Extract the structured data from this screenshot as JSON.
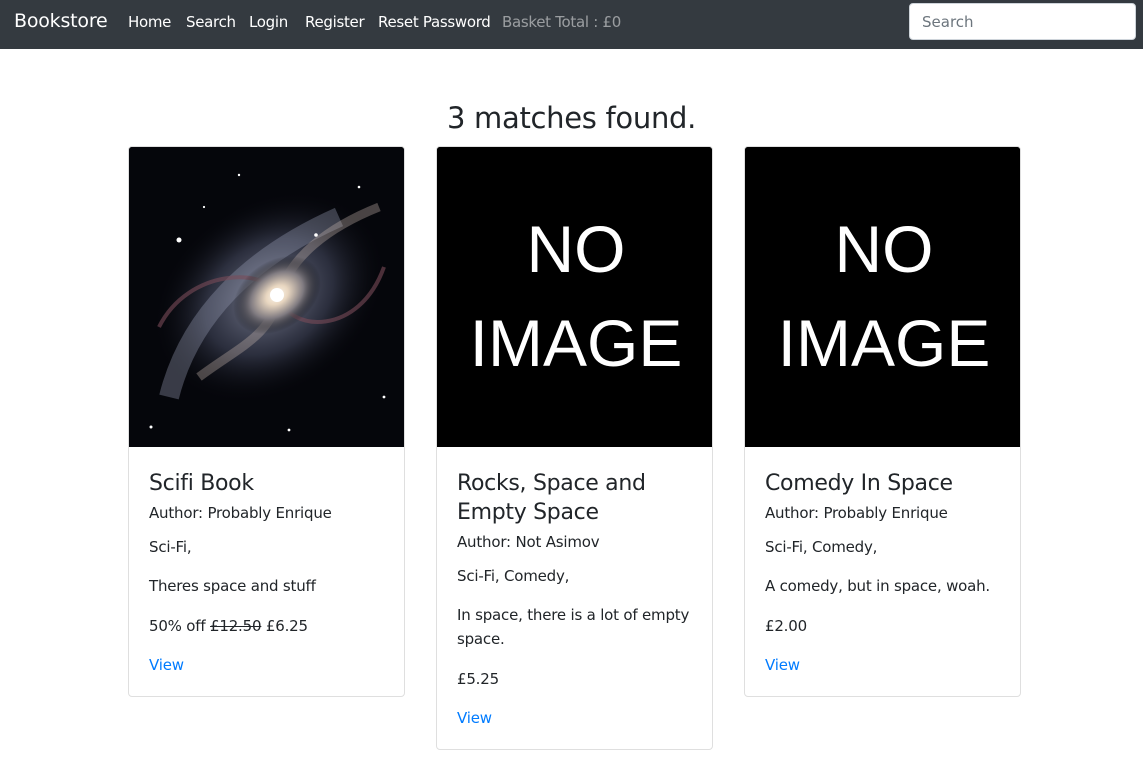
{
  "navbar": {
    "brand": "Bookstore",
    "links": [
      "Home",
      "Search",
      "Login",
      "Register",
      "Reset Password"
    ],
    "basket_total": "Basket Total : £0",
    "search_placeholder": "Search"
  },
  "results": {
    "heading": "3 matches found."
  },
  "books": [
    {
      "image": "galaxy-cover",
      "title": "Scifi Book",
      "author": "Author: Probably Enrique",
      "genres": "Sci-Fi,",
      "description": "Theres space and stuff",
      "discount_label": "50% off",
      "original_price": "£12.50",
      "price": "£6.25",
      "link": "View"
    },
    {
      "image": "no-image-placeholder",
      "image_text": [
        "NO",
        "IMAGE"
      ],
      "title": "Rocks, Space and Empty Space",
      "author": "Author: Not Asimov",
      "genres": "Sci-Fi, Comedy,",
      "description": "In space, there is a lot of empty space.",
      "price": "£5.25",
      "link": "View"
    },
    {
      "image": "no-image-placeholder",
      "image_text": [
        "NO",
        "IMAGE"
      ],
      "title": "Comedy In Space",
      "author": "Author: Probably Enrique",
      "genres": "Sci-Fi, Comedy,",
      "description": "A comedy, but in space, woah.",
      "price": "£2.00",
      "link": "View"
    }
  ],
  "colors": {
    "navbar_bg": "#343a40",
    "link": "#007bff",
    "text": "#212529",
    "muted_nav": "rgba(255,255,255,0.5)"
  }
}
